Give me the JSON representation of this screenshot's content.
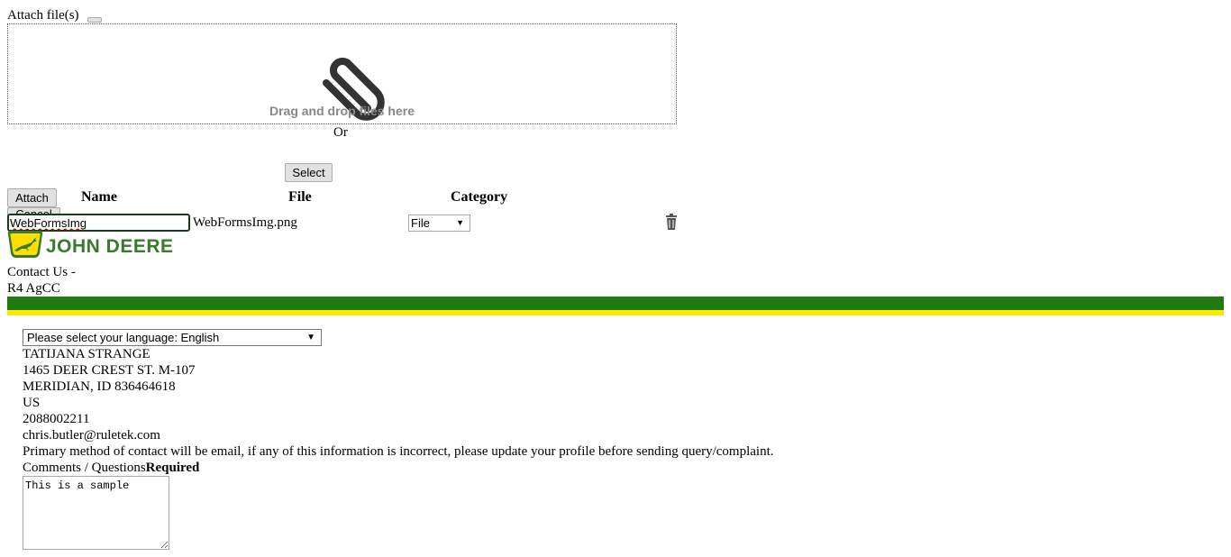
{
  "attachments": {
    "label": "Attach file(s)",
    "drop_text": "Drag and drop files here",
    "or_text": "Or",
    "select_button": "Select",
    "attach_button": "Attach",
    "cancel_button": "Cancel",
    "table": {
      "headers": {
        "name": "Name",
        "file": "File",
        "category": "Category"
      },
      "rows": [
        {
          "name_value": "WebFormsImg",
          "file": "WebFormsImg.png",
          "category": "File"
        }
      ]
    }
  },
  "icons": {
    "attachment": "paperclip-icon",
    "delete": "trash-icon",
    "logo": "leaping-deer-logo",
    "dropdown": "caret-down-icon"
  },
  "brand": {
    "name": "JOHN DEERE",
    "green": "#367c2b",
    "bar_green": "#1f7a0f",
    "bar_yellow": "#ffe800"
  },
  "header": {
    "title_line1": "Contact Us -",
    "title_line2": "R4 AgCC"
  },
  "language": {
    "selected": "Please select your language: English"
  },
  "profile": {
    "name": "TATIJANA STRANGE",
    "address1": "1465 DEER CREST ST. M-107",
    "city_line": "MERIDIAN, ID 836464618",
    "country": "US",
    "phone": "2088002211",
    "email": "chris.butler@ruletek.com",
    "notice": "Primary method of contact will be email, if any of this information is incorrect, please update your profile before sending query/complaint."
  },
  "comments": {
    "label": "Comments / Questions",
    "required": "Required",
    "value": "This is a sample"
  }
}
